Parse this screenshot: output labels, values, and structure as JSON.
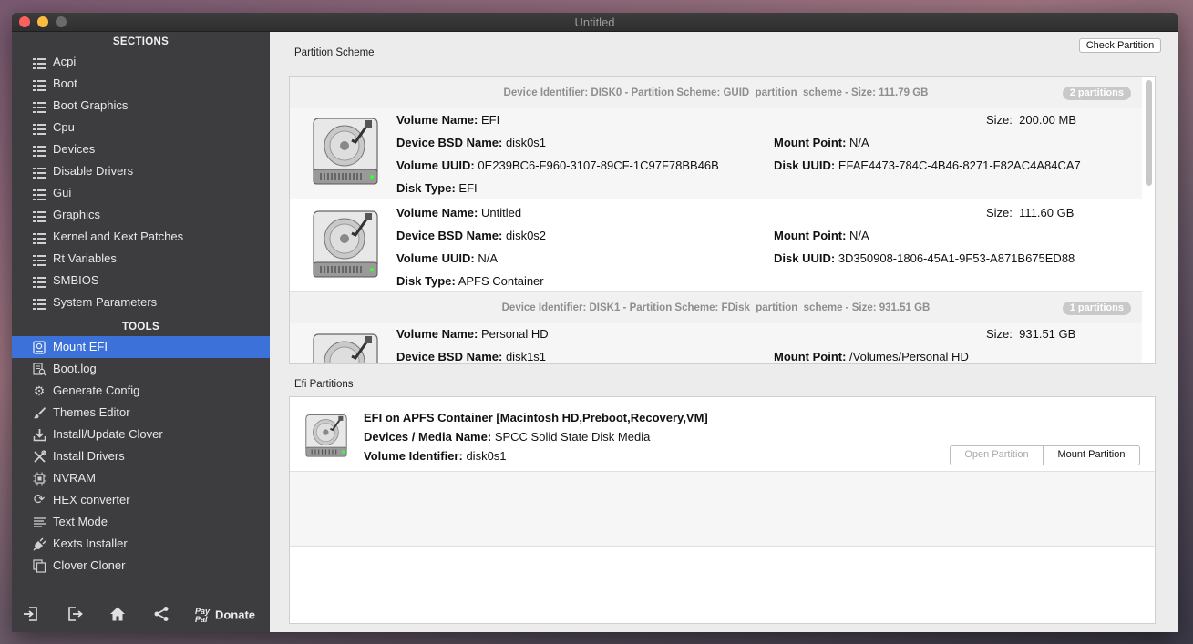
{
  "window": {
    "title": "Untitled"
  },
  "sidebar": {
    "sections_header": "SECTIONS",
    "sections": [
      {
        "label": "Acpi"
      },
      {
        "label": "Boot"
      },
      {
        "label": "Boot Graphics"
      },
      {
        "label": "Cpu"
      },
      {
        "label": "Devices"
      },
      {
        "label": "Disable Drivers"
      },
      {
        "label": "Gui"
      },
      {
        "label": "Graphics"
      },
      {
        "label": "Kernel and Kext Patches"
      },
      {
        "label": "Rt Variables"
      },
      {
        "label": "SMBIOS"
      },
      {
        "label": "System Parameters"
      }
    ],
    "tools_header": "TOOLS",
    "tools": [
      {
        "label": "Mount EFI",
        "icon": "disk-icon",
        "active": true
      },
      {
        "label": "Boot.log",
        "icon": "log-search-icon"
      },
      {
        "label": "Generate Config",
        "icon": "gears-icon"
      },
      {
        "label": "Themes Editor",
        "icon": "brush-icon"
      },
      {
        "label": "Install/Update Clover",
        "icon": "download-icon"
      },
      {
        "label": "Install Drivers",
        "icon": "wrench-icon"
      },
      {
        "label": "NVRAM",
        "icon": "chip-icon"
      },
      {
        "label": "HEX converter",
        "icon": "refresh-icon"
      },
      {
        "label": "Text Mode",
        "icon": "text-icon"
      },
      {
        "label": "Kexts Installer",
        "icon": "plug-icon"
      },
      {
        "label": "Clover Cloner",
        "icon": "copy-icon"
      }
    ],
    "footer": {
      "paypal": "Pay Pal",
      "donate": "Donate"
    }
  },
  "partition_scheme": {
    "label": "Partition Scheme",
    "check_button": "Check Partition",
    "devices": [
      {
        "header": "Device Identifier: DISK0 - Partition Scheme: GUID_partition_scheme - Size: 111.79 GB",
        "badge": "2 partitions",
        "partitions": [
          {
            "volume_name": "EFI",
            "size": "200.00 MB",
            "bsd_name": "disk0s1",
            "mount_point": "N/A",
            "volume_uuid": "0E239BC6-F960-3107-89CF-1C97F78BB46B",
            "disk_uuid": "EFAE4473-784C-4B46-8271-F82AC4A84CA7",
            "disk_type": "EFI"
          },
          {
            "volume_name": "Untitled",
            "size": "111.60 GB",
            "bsd_name": "disk0s2",
            "mount_point": "N/A",
            "volume_uuid": "N/A",
            "disk_uuid": "3D350908-1806-45A1-9F53-A871B675ED88",
            "disk_type": "APFS Container"
          }
        ]
      },
      {
        "header": "Device Identifier: DISK1 - Partition Scheme: FDisk_partition_scheme - Size: 931.51 GB",
        "badge": "1 partitions",
        "partitions": [
          {
            "volume_name": "Personal HD",
            "size": "931.51 GB",
            "bsd_name": "disk1s1",
            "mount_point": "/Volumes/Personal HD"
          }
        ]
      }
    ],
    "labels": {
      "volume_name": "Volume Name:",
      "size": "Size:",
      "bsd_name": "Device BSD Name:",
      "mount_point": "Mount Point:",
      "volume_uuid": "Volume UUID:",
      "disk_uuid": "Disk UUID:",
      "disk_type": "Disk Type:"
    }
  },
  "efi_partitions": {
    "label": "Efi Partitions",
    "entry": {
      "title": "EFI on APFS Container [Macintosh HD,Preboot,Recovery,VM]",
      "media_label": "Devices / Media Name:",
      "media_value": "SPCC Solid State Disk Media",
      "identifier_label": "Volume Identifier:",
      "identifier_value": "disk0s1"
    },
    "open_button": "Open Partition",
    "mount_button": "Mount Partition"
  }
}
